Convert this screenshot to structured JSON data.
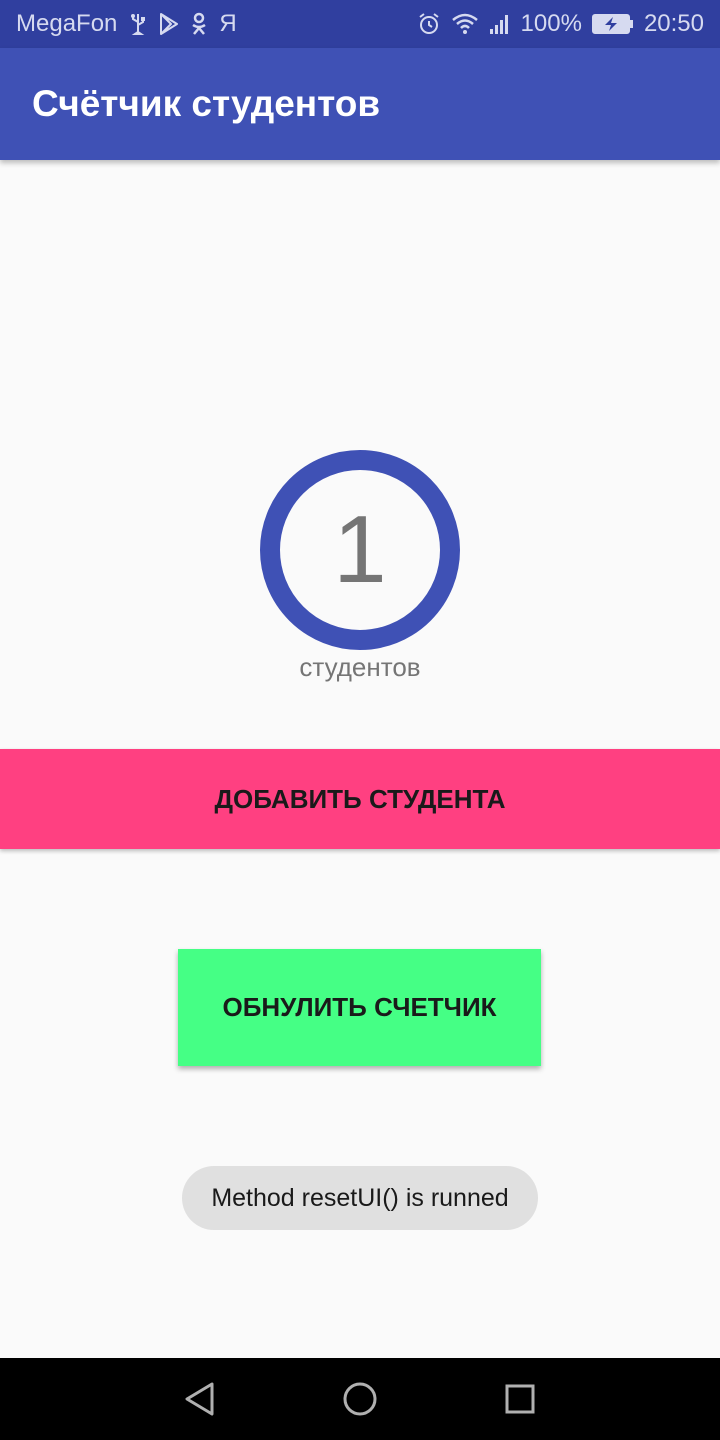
{
  "status_bar": {
    "carrier": "MegaFon",
    "notification_icons": [
      "usb-icon",
      "play-store-icon",
      "odnoklassniki-icon",
      "yandex-icon"
    ],
    "yandex_glyph": "Я",
    "battery": "100%",
    "time": "20:50"
  },
  "app_bar": {
    "title": "Счётчик студентов",
    "color": "#3f51b5"
  },
  "counter": {
    "value": "1",
    "label": "студентов",
    "ring_color": "#3f51b5"
  },
  "buttons": {
    "add_label": "ДОБАВИТЬ СТУДЕНТА",
    "add_color": "#ff4081",
    "reset_label": "ОБНУЛИТЬ СЧЕТЧИК",
    "reset_color": "#45ff85"
  },
  "toast": {
    "message": "Method resetUI() is runned"
  },
  "nav_bar": {
    "buttons": [
      "back-icon",
      "home-icon",
      "recents-icon"
    ]
  }
}
